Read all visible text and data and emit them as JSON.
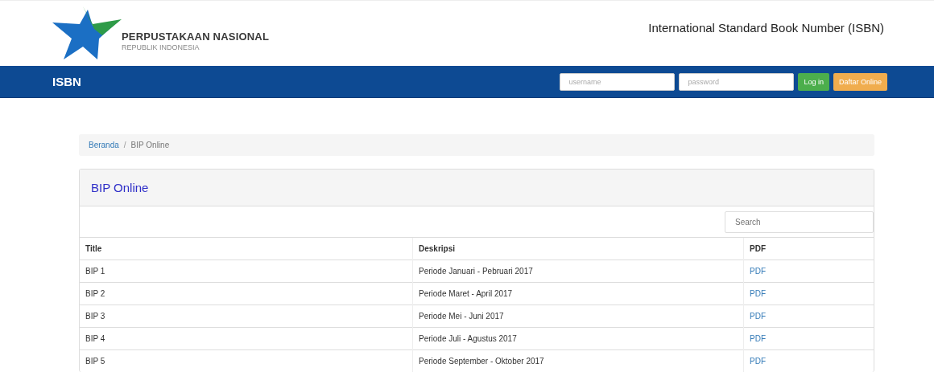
{
  "header": {
    "org_name": "PERPUSTAKAAN NASIONAL",
    "org_sub": "REPUBLIK INDONESIA",
    "site_title": "International Standard Book Number (ISBN)"
  },
  "navbar": {
    "brand": "ISBN",
    "username": {
      "placeholder": "username"
    },
    "password": {
      "placeholder": "password"
    },
    "buttons": [
      {
        "label": "Log in",
        "kind": "login"
      },
      {
        "label": "Daftar Online",
        "kind": "register"
      }
    ]
  },
  "breadcrumb": [
    {
      "label": "Beranda",
      "kind": "link"
    },
    {
      "label": "/",
      "kind": "separator"
    },
    {
      "label": "BIP Online",
      "kind": "current"
    }
  ],
  "panel": {
    "title": "BIP Online",
    "search": {
      "placeholder": "Search"
    },
    "table": {
      "columns": [
        "Title",
        "Deskripsi",
        "PDF"
      ],
      "rows": [
        [
          "BIP 1",
          "Periode Januari - Pebruari 2017",
          "PDF"
        ],
        [
          "BIP 2",
          "Periode Maret - April 2017",
          "PDF"
        ],
        [
          "BIP 3",
          "Periode Mei - Juni 2017",
          "PDF"
        ],
        [
          "BIP 4",
          "Periode Juli - Agustus 2017",
          "PDF"
        ],
        [
          "BIP 5",
          "Periode September - Oktober 2017",
          "PDF"
        ]
      ]
    }
  }
}
